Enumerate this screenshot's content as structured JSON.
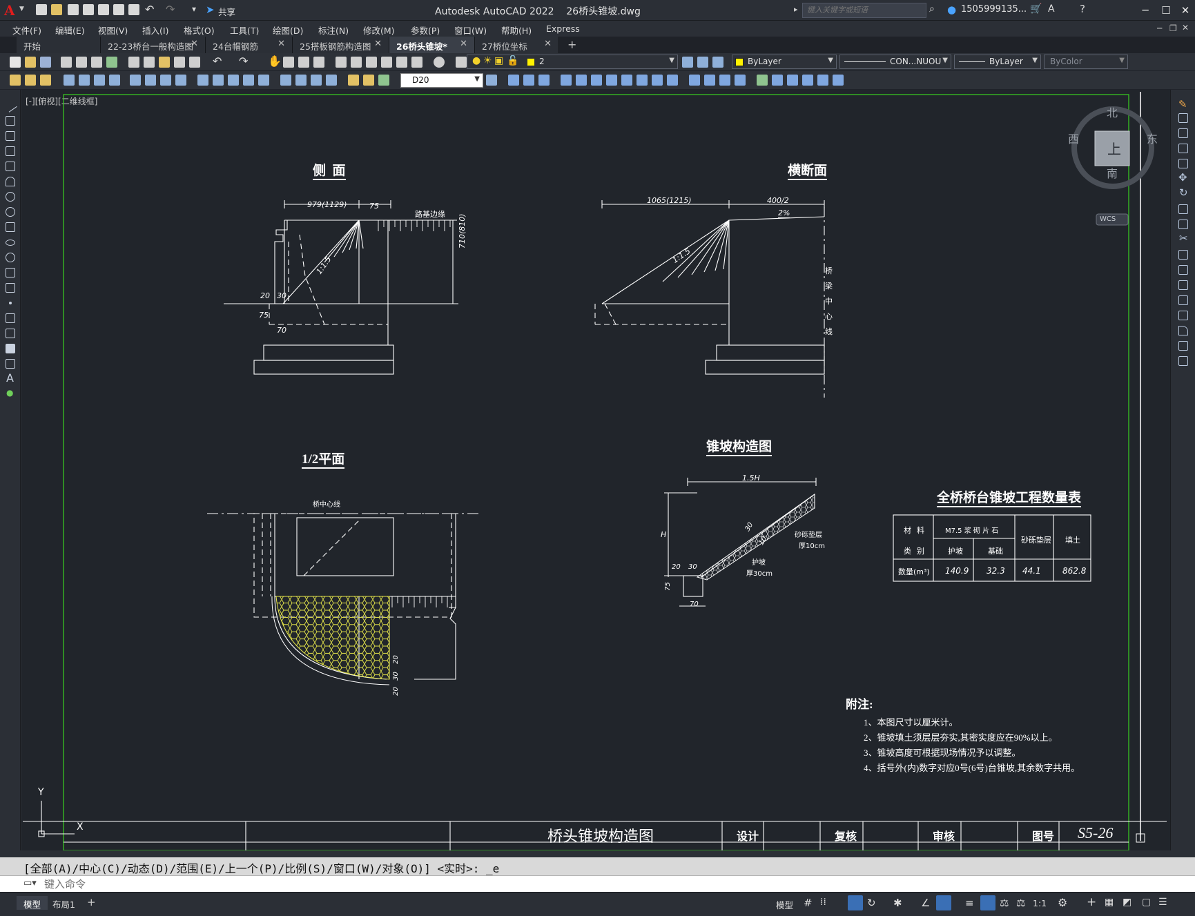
{
  "app": {
    "title": "Autodesk AutoCAD 2022    26桥头锥坡.dwg",
    "logo": "A",
    "share_label": "共享",
    "search_placeholder": "键入关键字或短语",
    "user": "1505999135...",
    "win_min": "─",
    "win_max": "☐",
    "win_close": "✕"
  },
  "menu": [
    "文件(F)",
    "编辑(E)",
    "视图(V)",
    "插入(I)",
    "格式(O)",
    "工具(T)",
    "绘图(D)",
    "标注(N)",
    "修改(M)",
    "参数(P)",
    "窗口(W)",
    "帮助(H)",
    "Express"
  ],
  "tabs": [
    {
      "label": "开始",
      "closable": false,
      "active": false
    },
    {
      "label": "22-23桥台一般构造图",
      "closable": true,
      "active": false
    },
    {
      "label": "24台帽钢筋",
      "closable": true,
      "active": false
    },
    {
      "label": "25搭板钢筋构造图",
      "closable": true,
      "active": false
    },
    {
      "label": "26桥头锥坡*",
      "closable": true,
      "active": true
    },
    {
      "label": "27桥位坐标",
      "closable": true,
      "active": false
    }
  ],
  "tab_add": "+",
  "tab_close_glyph": "✕",
  "toolbar": {
    "layer_value": "2",
    "color_value": "ByLayer",
    "linetype_value": "CON...NUOU",
    "lineweight_value": "ByLayer",
    "plotstyle_value": "ByColor",
    "dimstyle_value": "D20"
  },
  "viewport_label": "[-][俯视][二维线框]",
  "viewcube": {
    "north": "北",
    "south": "南",
    "east": "东",
    "west": "西",
    "top": "上",
    "wcs": "WCS"
  },
  "ucs": {
    "x": "X",
    "y": "Y"
  },
  "drawing": {
    "side_view_title": "侧  面",
    "cross_section_title": "横断面",
    "half_plan_title": "1/2平面",
    "cone_title": "锥坡构造图",
    "table_title": "全桥桥台锥坡工程数量表",
    "side": {
      "dim_top": "979(1129)",
      "dim_75": "75",
      "road_label": "路基边缘",
      "dim_height": "710(810)",
      "slope": "1:1.5",
      "dim_20": "20",
      "dim_30": "30",
      "dim_75b": "75",
      "dim_70": "70"
    },
    "cross": {
      "dim_left": "1065(1215)",
      "dim_right": "400/2",
      "grade": "2%",
      "slope": "1:1.5",
      "center_label": [
        "桥",
        "梁",
        "中",
        "心",
        "线"
      ]
    },
    "plan": {
      "center_label": "桥中心线",
      "dim_20a": "20",
      "dim_30": "30",
      "dim_20b": "20"
    },
    "cone": {
      "dim_top": "1.5H",
      "dim_h": "H",
      "dim_30a": "30",
      "dim_10": "10",
      "gravel": "砂砾垫层",
      "gravel_thick": "厚10cm",
      "protect": "护坡",
      "protect_thick": "厚30cm",
      "dim_20": "20",
      "dim_30": "30",
      "dim_75": "75",
      "dim_70": "70"
    },
    "table": {
      "h_material": "材料",
      "h_category": "类别",
      "h_stone": "M7.5 浆 砌 片 石",
      "h_slope": "护坡",
      "h_base": "基础",
      "h_gravel": "砂砾垫层",
      "h_fill": "填土",
      "row_label": "数量(m³)",
      "values": [
        "140.9",
        "32.3",
        "44.1",
        "862.8"
      ]
    },
    "notes_title": "附注:",
    "notes": [
      "1、本图尺寸以厘米计。",
      "2、锥坡填土须层层夯实,其密实度应在90%以上。",
      "3、锥坡高度可根据现场情况予以调整。",
      "4、括号外(内)数字对应0号(6号)台锥坡,其余数字共用。"
    ],
    "titleblock": {
      "name": "桥头锥坡构造图",
      "design": "设计",
      "review": "复核",
      "approve": "审核",
      "figno_label": "图号",
      "figno": "S5-26"
    }
  },
  "command": {
    "history": "[全部(A)/中心(C)/动态(D)/范围(E)/上一个(P)/比例(S)/窗口(W)/对象(O)] <实时>: _e",
    "placeholder": "键入命令"
  },
  "status": {
    "model_tab": "模型",
    "layout_tab": "布局1",
    "add": "+",
    "model_btn": "模型",
    "scale": "1:1"
  },
  "colors": {
    "accent_green": "#39d121",
    "hatch_yellow": "#e8e84a",
    "drawing_line": "#ffffff",
    "background": "#21252b",
    "logo_red": "#e11d1d"
  }
}
